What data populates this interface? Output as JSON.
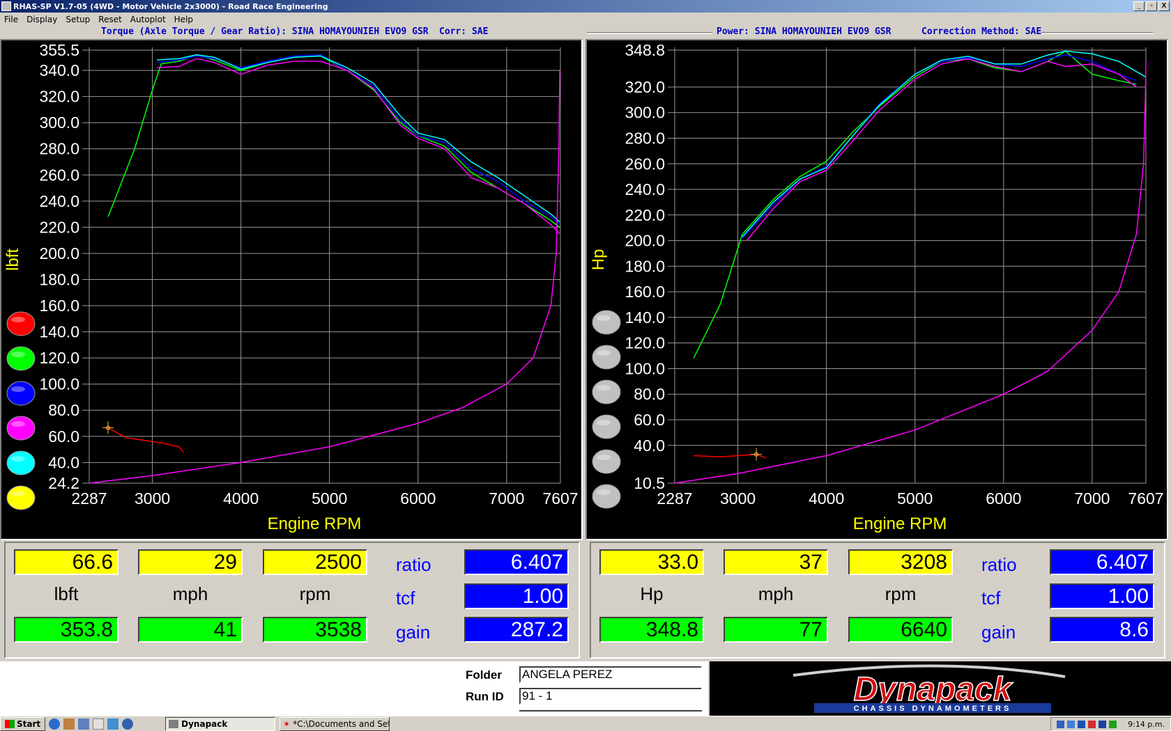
{
  "window": {
    "title": "RHAS-SP V1.7-05  (4WD - Motor Vehicle 2x3000) - Road Race Engineering",
    "controls": [
      "_",
      "▫",
      "X"
    ]
  },
  "menu": [
    "File",
    "Display",
    "Setup",
    "Reset",
    "Autoplot",
    "Help"
  ],
  "torque_panel": {
    "header": "Torque (Axle Torque / Gear Ratio): SINA HOMAYOUNIEH EVO9 GSR",
    "corr": "Corr: SAE",
    "ylabel": "lbft",
    "xlabel": "Engine RPM",
    "y_ticks": [
      "355.5",
      "340.0",
      "320.0",
      "300.0",
      "280.0",
      "260.0",
      "240.0",
      "220.0",
      "200.0",
      "180.0",
      "160.0",
      "140.0",
      "120.0",
      "100.0",
      "80.0",
      "60.0",
      "40.0",
      "24.2"
    ],
    "x_ticks": [
      "2287",
      "3000",
      "4000",
      "5000",
      "6000",
      "7000",
      "7607"
    ],
    "color_buttons": [
      "#ff0000",
      "#00ff00",
      "#0000ff",
      "#ff00ff",
      "#00ffff",
      "#ffff00"
    ]
  },
  "power_panel": {
    "header": "Power: SINA HOMAYOUNIEH EVO9 GSR",
    "corr": "Correction Method: SAE",
    "ylabel": "Hp",
    "xlabel": "Engine RPM",
    "y_ticks": [
      "348.8",
      "320.0",
      "300.0",
      "280.0",
      "260.0",
      "240.0",
      "220.0",
      "200.0",
      "180.0",
      "160.0",
      "140.0",
      "120.0",
      "100.0",
      "80.0",
      "60.0",
      "40.0",
      "10.5"
    ],
    "x_ticks": [
      "2287",
      "3000",
      "4000",
      "5000",
      "6000",
      "7000",
      "7607"
    ],
    "color_buttons": [
      "#c0c0c0",
      "#c0c0c0",
      "#c0c0c0",
      "#c0c0c0",
      "#c0c0c0",
      "#c0c0c0"
    ]
  },
  "chart_data": [
    {
      "type": "line",
      "title": "Torque (Axle Torque / Gear Ratio): SINA HOMAYOUNIEH EVO9 GSR",
      "xlabel": "Engine RPM",
      "ylabel": "lbft",
      "xlim": [
        2287,
        7607
      ],
      "ylim": [
        24.2,
        355.5
      ],
      "grid": true,
      "series": [
        {
          "color": "#00ff00",
          "x": [
            2500,
            2800,
            3000,
            3100,
            3300,
            3500,
            3700,
            4000,
            4300,
            4600,
            4900,
            5200,
            5500,
            5800,
            6000,
            6300,
            6600,
            6900,
            7200,
            7500,
            7600
          ],
          "y": [
            228,
            280,
            325,
            345,
            347,
            352,
            348,
            340,
            346,
            350,
            351,
            340,
            325,
            300,
            290,
            282,
            262,
            250,
            238,
            225,
            220
          ]
        },
        {
          "color": "#0000ff",
          "x": [
            3050,
            3300,
            3500,
            3700,
            4000,
            4300,
            4600,
            4900,
            5200,
            5500,
            5800,
            6000,
            6300,
            6600,
            6900,
            7200,
            7500,
            7600
          ],
          "y": [
            346,
            348,
            351,
            349,
            342,
            347,
            351,
            352,
            340,
            328,
            302,
            290,
            285,
            265,
            255,
            240,
            228,
            222
          ]
        },
        {
          "color": "#ff00ff",
          "x": [
            3050,
            3300,
            3500,
            3700,
            4000,
            4300,
            4600,
            4900,
            5200,
            5500,
            5800,
            6000,
            6300,
            6600,
            6900,
            7200,
            7500,
            7600
          ],
          "y": [
            342,
            343,
            349,
            346,
            337,
            344,
            347,
            347,
            340,
            326,
            298,
            288,
            280,
            258,
            250,
            238,
            222,
            215
          ]
        },
        {
          "color": "#00ffff",
          "x": [
            3050,
            3300,
            3500,
            3700,
            4000,
            4300,
            4600,
            4900,
            5200,
            5500,
            5800,
            6000,
            6300,
            6600,
            6900,
            7200,
            7500,
            7600
          ],
          "y": [
            348,
            349,
            352,
            350,
            341,
            346,
            350,
            351,
            342,
            330,
            305,
            292,
            287,
            270,
            258,
            244,
            230,
            224
          ]
        },
        {
          "color": "#ff0000",
          "x": [
            2500,
            2700,
            2900,
            3100,
            3300,
            3350
          ],
          "y": [
            66.6,
            59,
            57,
            55,
            52,
            48
          ]
        },
        {
          "color": "#ff00ff",
          "x": [
            2287,
            3000,
            4000,
            5000,
            6000,
            6500,
            7000,
            7300,
            7500,
            7560,
            7590,
            7600
          ],
          "y": [
            24.2,
            30,
            40,
            52,
            70,
            82,
            100,
            120,
            160,
            200,
            280,
            340
          ]
        }
      ]
    },
    {
      "type": "line",
      "title": "Power: SINA HOMAYOUNIEH EVO9 GSR",
      "xlabel": "Engine RPM",
      "ylabel": "Hp",
      "xlim": [
        2287,
        7607
      ],
      "ylim": [
        10.5,
        348.8
      ],
      "grid": true,
      "series": [
        {
          "color": "#00ff00",
          "x": [
            2500,
            2800,
            3050,
            3400,
            3700,
            4000,
            4300,
            4600,
            5000,
            5300,
            5600,
            5900,
            6200,
            6500,
            6700,
            7000,
            7300,
            7500
          ],
          "y": [
            108,
            150,
            205,
            232,
            250,
            262,
            285,
            305,
            328,
            340,
            342,
            335,
            332,
            340,
            348,
            330,
            325,
            322
          ]
        },
        {
          "color": "#0000ff",
          "x": [
            3050,
            3400,
            3700,
            4000,
            4300,
            4600,
            5000,
            5300,
            5600,
            5900,
            6200,
            6500,
            6700,
            7000,
            7300,
            7500
          ],
          "y": [
            202,
            228,
            248,
            258,
            282,
            307,
            330,
            340,
            343,
            338,
            336,
            342,
            345,
            340,
            330,
            325
          ]
        },
        {
          "color": "#ff00ff",
          "x": [
            3100,
            3400,
            3700,
            4000,
            4300,
            4600,
            5000,
            5300,
            5600,
            5900,
            6200,
            6500,
            6700,
            7000,
            7300,
            7500
          ],
          "y": [
            200,
            225,
            246,
            255,
            278,
            302,
            326,
            338,
            342,
            336,
            332,
            340,
            336,
            338,
            330,
            320
          ]
        },
        {
          "color": "#00ffff",
          "x": [
            3050,
            3400,
            3700,
            4000,
            4300,
            4600,
            5000,
            5300,
            5600,
            5900,
            6200,
            6500,
            6700,
            7000,
            7300,
            7600
          ],
          "y": [
            203,
            230,
            248,
            257,
            282,
            306,
            330,
            341,
            344,
            338,
            338,
            345,
            348,
            346,
            340,
            328
          ]
        },
        {
          "color": "#ff0000",
          "x": [
            2500,
            2800,
            3000,
            3208,
            3320
          ],
          "y": [
            32,
            31,
            32,
            33,
            30
          ]
        },
        {
          "color": "#ff00ff",
          "x": [
            2287,
            3000,
            4000,
            5000,
            6000,
            6500,
            7000,
            7300,
            7500,
            7580,
            7600,
            7607
          ],
          "y": [
            10.5,
            18,
            32,
            52,
            80,
            98,
            130,
            160,
            205,
            260,
            310,
            340
          ]
        }
      ]
    }
  ],
  "torque_readout": {
    "current": {
      "lbft": "66.6",
      "mph": "29",
      "rpm": "2500"
    },
    "labels": {
      "lbft": "lbft",
      "mph": "mph",
      "rpm": "rpm"
    },
    "peak": {
      "lbft": "353.8",
      "mph": "41",
      "rpm": "3538"
    },
    "ratio_label": "ratio",
    "ratio": "6.407",
    "tcf_label": "tcf",
    "tcf": "1.00",
    "gain_label": "gain",
    "gain": "287.2"
  },
  "power_readout": {
    "current": {
      "hp": "33.0",
      "mph": "37",
      "rpm": "3208"
    },
    "labels": {
      "hp": "Hp",
      "mph": "mph",
      "rpm": "rpm"
    },
    "peak": {
      "hp": "348.8",
      "mph": "77",
      "rpm": "6640"
    },
    "ratio_label": "ratio",
    "ratio": "6.407",
    "tcf_label": "tcf",
    "tcf": "1.00",
    "gain_label": "gain",
    "gain": "8.6"
  },
  "run_info": {
    "folder_label": "Folder",
    "folder": "ANGELA PEREZ",
    "runid_label": "Run ID",
    "runid": "91 - 1"
  },
  "logo": {
    "brand": "Dynapack",
    "tagline": "CHASSIS DYNAMOMETERS"
  },
  "taskbar": {
    "start": "Start",
    "tasks": [
      "Dynapack",
      "*C:\\Documents and Setti..."
    ],
    "clock": "9:14 p.m."
  }
}
